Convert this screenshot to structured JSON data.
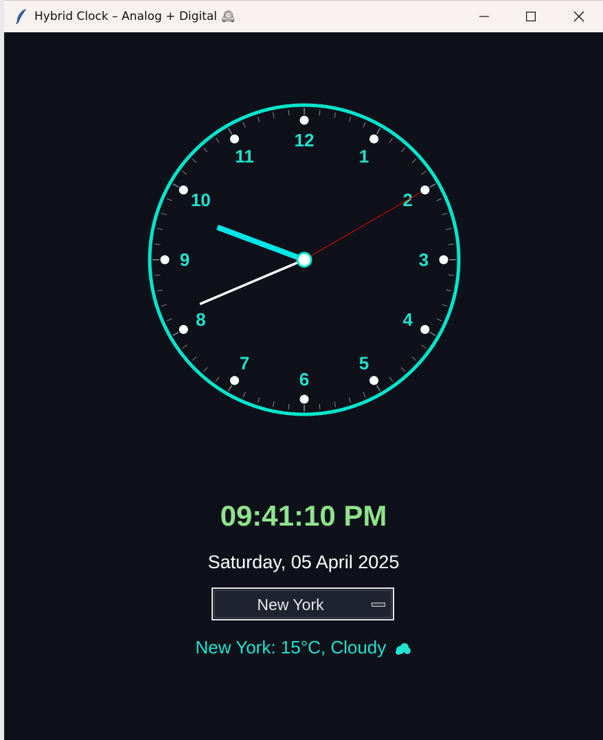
{
  "window": {
    "title": "Hybrid Clock – Analog + Digital",
    "title_emoji": "🕰"
  },
  "clock": {
    "numbers": [
      "12",
      "1",
      "2",
      "3",
      "4",
      "5",
      "6",
      "7",
      "8",
      "9",
      "10",
      "11"
    ],
    "time": {
      "hours": 9,
      "minutes": 41,
      "seconds": 10
    },
    "colors": {
      "face": "#0f111a",
      "ring": "#00e5cc",
      "numbers": "#20e3cf",
      "hour_hand": "#00e5e5",
      "minute_hand": "#ffffff",
      "second_hand": "#cc0000",
      "ticks": "#8a8a8a",
      "dots": "#ffffff"
    }
  },
  "digital": {
    "time": "09:41:10 PM",
    "date": "Saturday, 05 April 2025"
  },
  "city_selector": {
    "selected": "New York"
  },
  "weather": {
    "text": "New York: 15°C, Cloudy"
  },
  "icons": {
    "app": "feather-icon",
    "cloud": "cloud-icon"
  }
}
